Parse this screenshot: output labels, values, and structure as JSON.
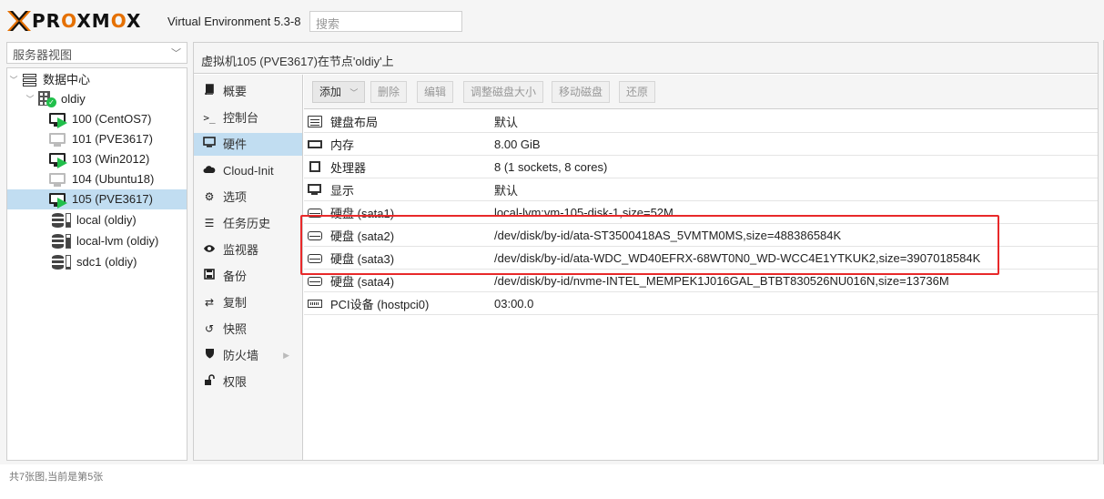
{
  "header": {
    "logo_text": "PROXMOX",
    "product": "Virtual Environment 5.3-8",
    "search_placeholder": "搜索"
  },
  "view_selector": {
    "value": "服务器视图"
  },
  "tree": {
    "datacenter": "数据中心",
    "node": "oldiy",
    "vms": [
      {
        "label": "100 (CentOS7)",
        "running": true
      },
      {
        "label": "101 (PVE3617)",
        "running": false
      },
      {
        "label": "103 (Win2012)",
        "running": true
      },
      {
        "label": "104 (Ubuntu18)",
        "running": false
      },
      {
        "label": "105 (PVE3617)",
        "running": true,
        "selected": true
      }
    ],
    "storages": [
      {
        "label": "local (oldiy)"
      },
      {
        "label": "local-lvm (oldiy)"
      },
      {
        "label": "sdc1 (oldiy)"
      }
    ]
  },
  "content": {
    "title": "虚拟机105 (PVE3617)在节点'oldiy'上",
    "menu": [
      {
        "label": "概要",
        "icon": "book-icon"
      },
      {
        "label": "控制台",
        "icon": "terminal-icon"
      },
      {
        "label": "硬件",
        "icon": "desktop-icon",
        "active": true
      },
      {
        "label": "Cloud-Init",
        "icon": "cloud-icon"
      },
      {
        "label": "选项",
        "icon": "gear-icon"
      },
      {
        "label": "任务历史",
        "icon": "list-icon"
      },
      {
        "label": "监视器",
        "icon": "eye-icon"
      },
      {
        "label": "备份",
        "icon": "floppy-icon"
      },
      {
        "label": "复制",
        "icon": "retweet-icon"
      },
      {
        "label": "快照",
        "icon": "history-icon"
      },
      {
        "label": "防火墙",
        "icon": "shield-icon",
        "has_submenu": true
      },
      {
        "label": "权限",
        "icon": "unlock-icon"
      }
    ],
    "toolbar": {
      "add": "添加",
      "remove": "删除",
      "edit": "编辑",
      "resize": "调整磁盘大小",
      "move": "移动磁盘",
      "revert": "还原"
    },
    "hardware": [
      {
        "name": "键盘布局",
        "value": "默认",
        "icon": "keyboard-icon"
      },
      {
        "name": "内存",
        "value": "8.00 GiB",
        "icon": "memory-icon"
      },
      {
        "name": "处理器",
        "value": "8 (1 sockets, 8 cores)",
        "icon": "cpu-icon"
      },
      {
        "name": "显示",
        "value": "默认",
        "icon": "display-icon"
      },
      {
        "name": "硬盘 (sata1)",
        "value": "local-lvm:vm-105-disk-1,size=52M",
        "icon": "hdd-icon"
      },
      {
        "name": "硬盘 (sata2)",
        "value": "/dev/disk/by-id/ata-ST3500418AS_5VMTM0MS,size=488386584K",
        "icon": "hdd-icon"
      },
      {
        "name": "硬盘 (sata3)",
        "value": "/dev/disk/by-id/ata-WDC_WD40EFRX-68WT0N0_WD-WCC4E1YTKUK2,size=3907018584K",
        "icon": "hdd-icon"
      },
      {
        "name": "硬盘 (sata4)",
        "value": "/dev/disk/by-id/nvme-INTEL_MEMPEK1J016GAL_BTBT830526NU016N,size=13736M",
        "icon": "hdd-icon"
      },
      {
        "name": "PCI设备 (hostpci0)",
        "value": "03:00.0",
        "icon": "pci-icon"
      }
    ]
  },
  "footer": {
    "status": "共7张图,当前是第5张"
  },
  "colors": {
    "accent_orange": "#e57000",
    "selection": "#c1ddf1",
    "running_green": "#21bf4b",
    "highlight_red": "#e8292a"
  }
}
